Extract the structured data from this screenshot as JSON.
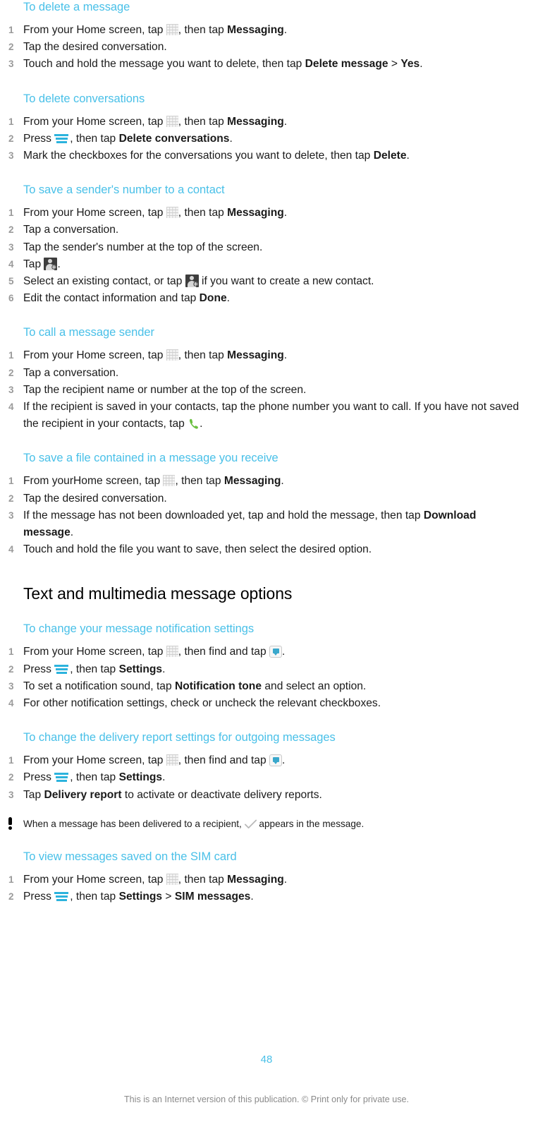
{
  "document": {
    "page_number": "48",
    "footer_text": "This is an Internet version of this publication. © Print only for private use.",
    "heading_color": "#49c0e8",
    "body_color": "#1a1a1a",
    "step_number_color": "#9a9a9a",
    "phone_icon_color": "#6abf3f",
    "menu_icon_color": "#2cb3dd"
  },
  "icons": {
    "app_drawer": "app-drawer-grid-icon",
    "menu": "menu-hamburger-icon",
    "add_contact": "add-contact-icon",
    "phone": "phone-handset-icon",
    "messaging": "messaging-app-icon",
    "delivered_check": "delivered-checkmark-icon",
    "note": "note-exclamation-icon"
  },
  "procedures": [
    {
      "id": "delete-a-message",
      "title": "To delete a message",
      "steps": [
        {
          "parts": [
            {
              "t": "text",
              "v": "From your Home screen, tap "
            },
            {
              "t": "icon",
              "v": "app_drawer"
            },
            {
              "t": "text",
              "v": ", then tap "
            },
            {
              "t": "bold",
              "v": "Messaging"
            },
            {
              "t": "text",
              "v": "."
            }
          ]
        },
        {
          "parts": [
            {
              "t": "text",
              "v": "Tap the desired conversation."
            }
          ]
        },
        {
          "parts": [
            {
              "t": "text",
              "v": "Touch and hold the message you want to delete, then tap "
            },
            {
              "t": "bold",
              "v": "Delete message"
            },
            {
              "t": "text",
              "v": " > "
            },
            {
              "t": "bold",
              "v": "Yes"
            },
            {
              "t": "text",
              "v": "."
            }
          ]
        }
      ]
    },
    {
      "id": "delete-conversations",
      "title": "To delete conversations",
      "steps": [
        {
          "parts": [
            {
              "t": "text",
              "v": "From your Home screen, tap "
            },
            {
              "t": "icon",
              "v": "app_drawer"
            },
            {
              "t": "text",
              "v": ", then tap "
            },
            {
              "t": "bold",
              "v": "Messaging"
            },
            {
              "t": "text",
              "v": "."
            }
          ]
        },
        {
          "parts": [
            {
              "t": "text",
              "v": "Press "
            },
            {
              "t": "icon",
              "v": "menu"
            },
            {
              "t": "text",
              "v": ", then tap "
            },
            {
              "t": "bold",
              "v": "Delete conversations"
            },
            {
              "t": "text",
              "v": "."
            }
          ]
        },
        {
          "parts": [
            {
              "t": "text",
              "v": "Mark the checkboxes for the conversations you want to delete, then tap "
            },
            {
              "t": "bold",
              "v": "Delete"
            },
            {
              "t": "text",
              "v": "."
            }
          ]
        }
      ]
    },
    {
      "id": "save-senders-number-to-contact",
      "title": "To save a sender's number to a contact",
      "steps": [
        {
          "parts": [
            {
              "t": "text",
              "v": "From your Home screen, tap "
            },
            {
              "t": "icon",
              "v": "app_drawer"
            },
            {
              "t": "text",
              "v": ", then tap "
            },
            {
              "t": "bold",
              "v": "Messaging"
            },
            {
              "t": "text",
              "v": "."
            }
          ]
        },
        {
          "parts": [
            {
              "t": "text",
              "v": "Tap a conversation."
            }
          ]
        },
        {
          "parts": [
            {
              "t": "text",
              "v": "Tap the sender's number at the top of the screen."
            }
          ]
        },
        {
          "parts": [
            {
              "t": "text",
              "v": "Tap "
            },
            {
              "t": "icon",
              "v": "add_contact"
            },
            {
              "t": "text",
              "v": "."
            }
          ]
        },
        {
          "parts": [
            {
              "t": "text",
              "v": "Select an existing contact, or tap "
            },
            {
              "t": "icon",
              "v": "add_contact"
            },
            {
              "t": "text",
              "v": " if you want to create a new contact."
            }
          ]
        },
        {
          "parts": [
            {
              "t": "text",
              "v": "Edit the contact information and tap "
            },
            {
              "t": "bold",
              "v": "Done"
            },
            {
              "t": "text",
              "v": "."
            }
          ]
        }
      ]
    },
    {
      "id": "call-a-message-sender",
      "title": "To call a message sender",
      "steps": [
        {
          "parts": [
            {
              "t": "text",
              "v": "From your Home screen, tap "
            },
            {
              "t": "icon",
              "v": "app_drawer"
            },
            {
              "t": "text",
              "v": ", then tap "
            },
            {
              "t": "bold",
              "v": "Messaging"
            },
            {
              "t": "text",
              "v": "."
            }
          ]
        },
        {
          "parts": [
            {
              "t": "text",
              "v": "Tap a conversation."
            }
          ]
        },
        {
          "parts": [
            {
              "t": "text",
              "v": "Tap the recipient name or number at the top of the screen."
            }
          ]
        },
        {
          "parts": [
            {
              "t": "text",
              "v": "If the recipient is saved in your contacts, tap the phone number you want to call. If you have not saved the recipient in your contacts, tap "
            },
            {
              "t": "icon",
              "v": "phone"
            },
            {
              "t": "text",
              "v": "."
            }
          ]
        }
      ]
    },
    {
      "id": "save-a-file-in-a-message",
      "title": "To save a file contained in a message you receive",
      "steps": [
        {
          "parts": [
            {
              "t": "text",
              "v": "From yourHome screen, tap "
            },
            {
              "t": "icon",
              "v": "app_drawer"
            },
            {
              "t": "text",
              "v": ", then tap "
            },
            {
              "t": "bold",
              "v": "Messaging"
            },
            {
              "t": "text",
              "v": "."
            }
          ]
        },
        {
          "parts": [
            {
              "t": "text",
              "v": "Tap the desired conversation."
            }
          ]
        },
        {
          "parts": [
            {
              "t": "text",
              "v": "If the message has not been downloaded yet, tap and hold the message, then tap "
            },
            {
              "t": "bold",
              "v": "Download message"
            },
            {
              "t": "text",
              "v": "."
            }
          ]
        },
        {
          "parts": [
            {
              "t": "text",
              "v": "Touch and hold the file you want to save, then select the desired option."
            }
          ]
        }
      ]
    }
  ],
  "section": {
    "title": "Text and multimedia message options",
    "procedures": [
      {
        "id": "change-message-notification-settings",
        "title": "To change your message notification settings",
        "steps": [
          {
            "parts": [
              {
                "t": "text",
                "v": "From your Home screen, tap "
              },
              {
                "t": "icon",
                "v": "app_drawer"
              },
              {
                "t": "text",
                "v": ", then find and tap "
              },
              {
                "t": "icon",
                "v": "messaging"
              },
              {
                "t": "text",
                "v": "."
              }
            ]
          },
          {
            "parts": [
              {
                "t": "text",
                "v": "Press "
              },
              {
                "t": "icon",
                "v": "menu"
              },
              {
                "t": "text",
                "v": ", then tap "
              },
              {
                "t": "bold",
                "v": "Settings"
              },
              {
                "t": "text",
                "v": "."
              }
            ]
          },
          {
            "parts": [
              {
                "t": "text",
                "v": "To set a notification sound, tap "
              },
              {
                "t": "bold",
                "v": "Notification tone"
              },
              {
                "t": "text",
                "v": " and select an option."
              }
            ]
          },
          {
            "parts": [
              {
                "t": "text",
                "v": "For other notification settings, check or uncheck the relevant checkboxes."
              }
            ]
          }
        ]
      },
      {
        "id": "change-delivery-report-settings",
        "title": "To change the delivery report settings for outgoing messages",
        "steps": [
          {
            "parts": [
              {
                "t": "text",
                "v": "From your Home screen, tap "
              },
              {
                "t": "icon",
                "v": "app_drawer"
              },
              {
                "t": "text",
                "v": ", then find and tap "
              },
              {
                "t": "icon",
                "v": "messaging"
              },
              {
                "t": "text",
                "v": "."
              }
            ]
          },
          {
            "parts": [
              {
                "t": "text",
                "v": "Press "
              },
              {
                "t": "icon",
                "v": "menu"
              },
              {
                "t": "text",
                "v": ", then tap "
              },
              {
                "t": "bold",
                "v": "Settings"
              },
              {
                "t": "text",
                "v": "."
              }
            ]
          },
          {
            "parts": [
              {
                "t": "text",
                "v": "Tap "
              },
              {
                "t": "bold",
                "v": "Delivery report"
              },
              {
                "t": "text",
                "v": " to activate or deactivate delivery reports."
              }
            ]
          }
        ],
        "note": {
          "parts": [
            {
              "t": "text",
              "v": "When a message has been delivered to a recipient, "
            },
            {
              "t": "icon",
              "v": "delivered_check"
            },
            {
              "t": "text",
              "v": " appears in the message."
            }
          ]
        }
      },
      {
        "id": "view-messages-saved-on-sim",
        "title": "To view messages saved on the SIM card",
        "steps": [
          {
            "parts": [
              {
                "t": "text",
                "v": "From your Home screen, tap "
              },
              {
                "t": "icon",
                "v": "app_drawer"
              },
              {
                "t": "text",
                "v": ", then tap "
              },
              {
                "t": "bold",
                "v": "Messaging"
              },
              {
                "t": "text",
                "v": "."
              }
            ]
          },
          {
            "parts": [
              {
                "t": "text",
                "v": "Press "
              },
              {
                "t": "icon",
                "v": "menu"
              },
              {
                "t": "text",
                "v": ", then tap "
              },
              {
                "t": "bold",
                "v": "Settings"
              },
              {
                "t": "text",
                "v": " > "
              },
              {
                "t": "bold",
                "v": "SIM messages"
              },
              {
                "t": "text",
                "v": "."
              }
            ]
          }
        ]
      }
    ]
  }
}
